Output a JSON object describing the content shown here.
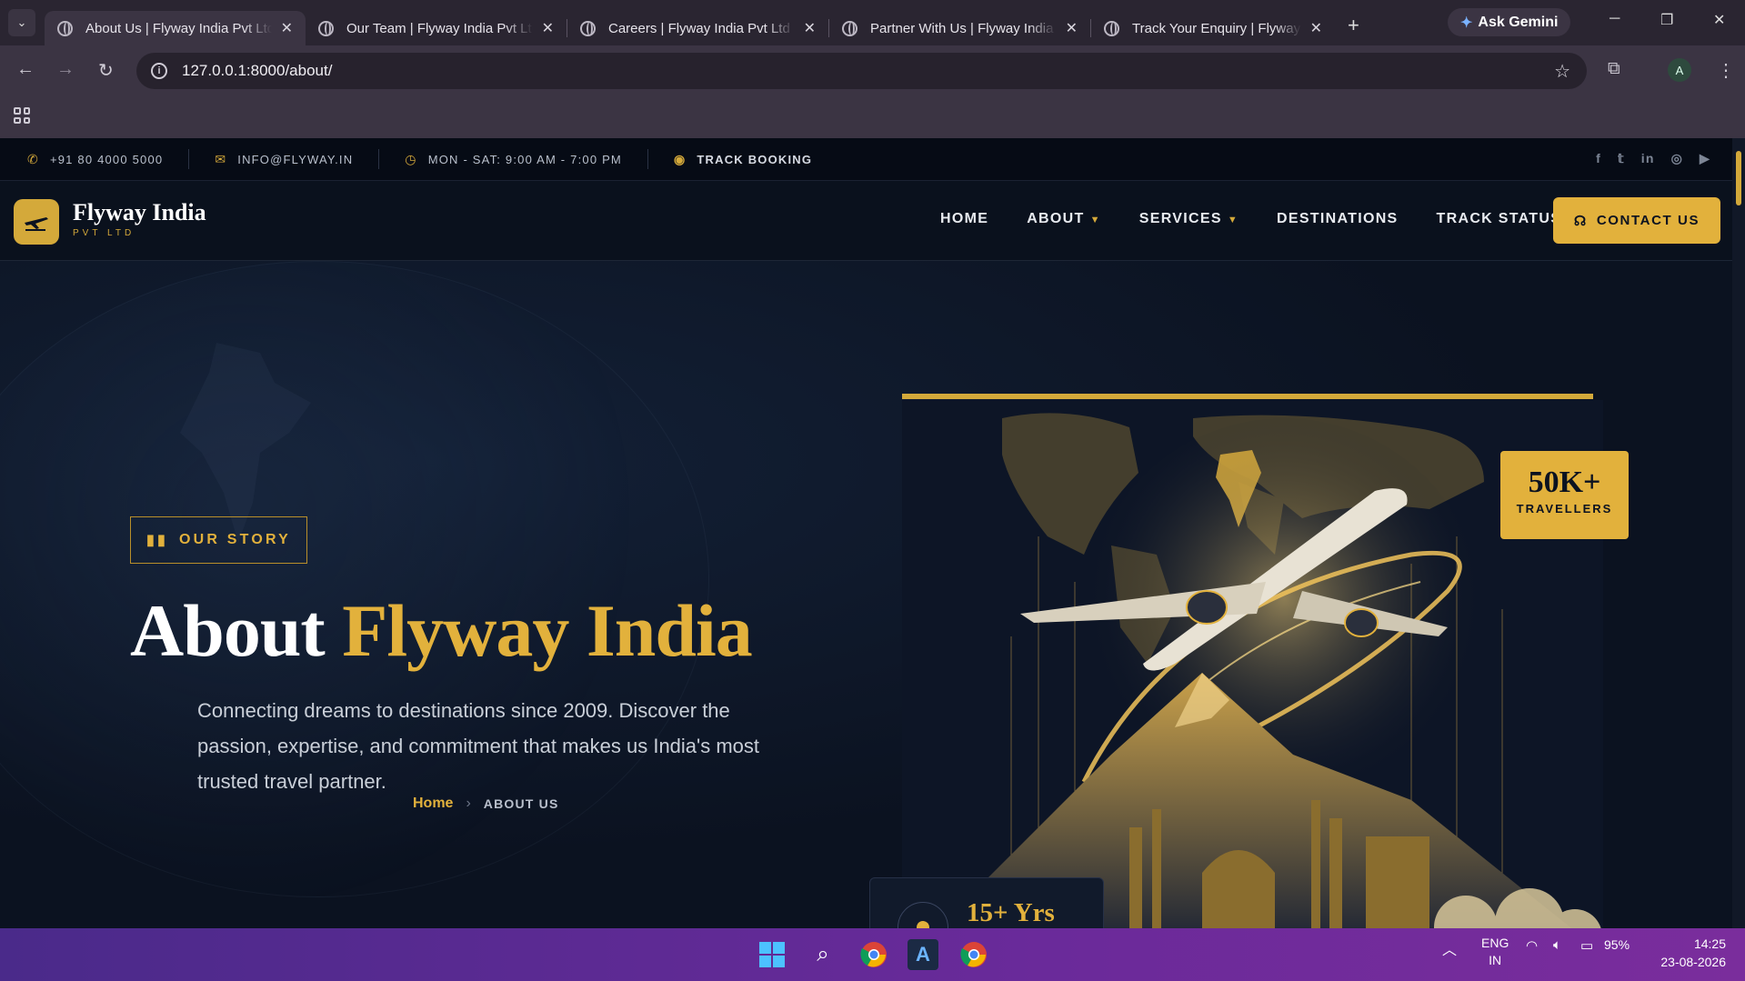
{
  "browser": {
    "tabs": [
      {
        "label": "About Us | Flyway India Pvt Ltd",
        "active": true
      },
      {
        "label": "Our Team | Flyway India Pvt Ltd",
        "active": false
      },
      {
        "label": "Careers | Flyway India Pvt Ltd",
        "active": false
      },
      {
        "label": "Partner With Us | Flyway India",
        "active": false
      },
      {
        "label": "Track Your Enquiry | Flyway India",
        "active": false
      }
    ],
    "gemini_label": "Ask Gemini",
    "url": "127.0.0.1:8000/about/",
    "profile_initial": "A"
  },
  "topbar": {
    "phone": "+91 80 4000 5000",
    "email": "INFO@FLYWAY.IN",
    "hours": "MON - SAT: 9:00 AM - 7:00 PM",
    "track": "TRACK BOOKING",
    "socials": [
      "facebook-icon",
      "twitter-icon",
      "linkedin-icon",
      "instagram-icon",
      "youtube-icon"
    ]
  },
  "nav": {
    "brand": "Flyway India",
    "brand_sub": "PVT LTD",
    "items": [
      {
        "label": "HOME",
        "dropdown": false
      },
      {
        "label": "ABOUT",
        "dropdown": true
      },
      {
        "label": "SERVICES",
        "dropdown": true
      },
      {
        "label": "DESTINATIONS",
        "dropdown": false
      },
      {
        "label": "TRACK STATUS",
        "dropdown": false
      }
    ],
    "contact": "CONTACT US"
  },
  "hero": {
    "badge": "OUR STORY",
    "title_white": "About",
    "title_gold": "Flyway India",
    "description": "Connecting dreams to destinations since 2009. Discover the passion, expertise, and commitment that makes us India's most trusted travel partner.",
    "breadcrumb_home": "Home",
    "breadcrumb_current": "ABOUT US",
    "stat_value": "50K+",
    "stat_label": "TRAVELLERS",
    "experience_value": "15+ Yrs"
  },
  "taskbar": {
    "lang_top": "ENG",
    "lang_bottom": "IN",
    "battery": "95%",
    "time": "14:25",
    "date": "23-08-2026"
  },
  "colors": {
    "accent": "#e2b13c",
    "page_bg": "#0b1220",
    "taskbar": "#6a2a9a"
  }
}
